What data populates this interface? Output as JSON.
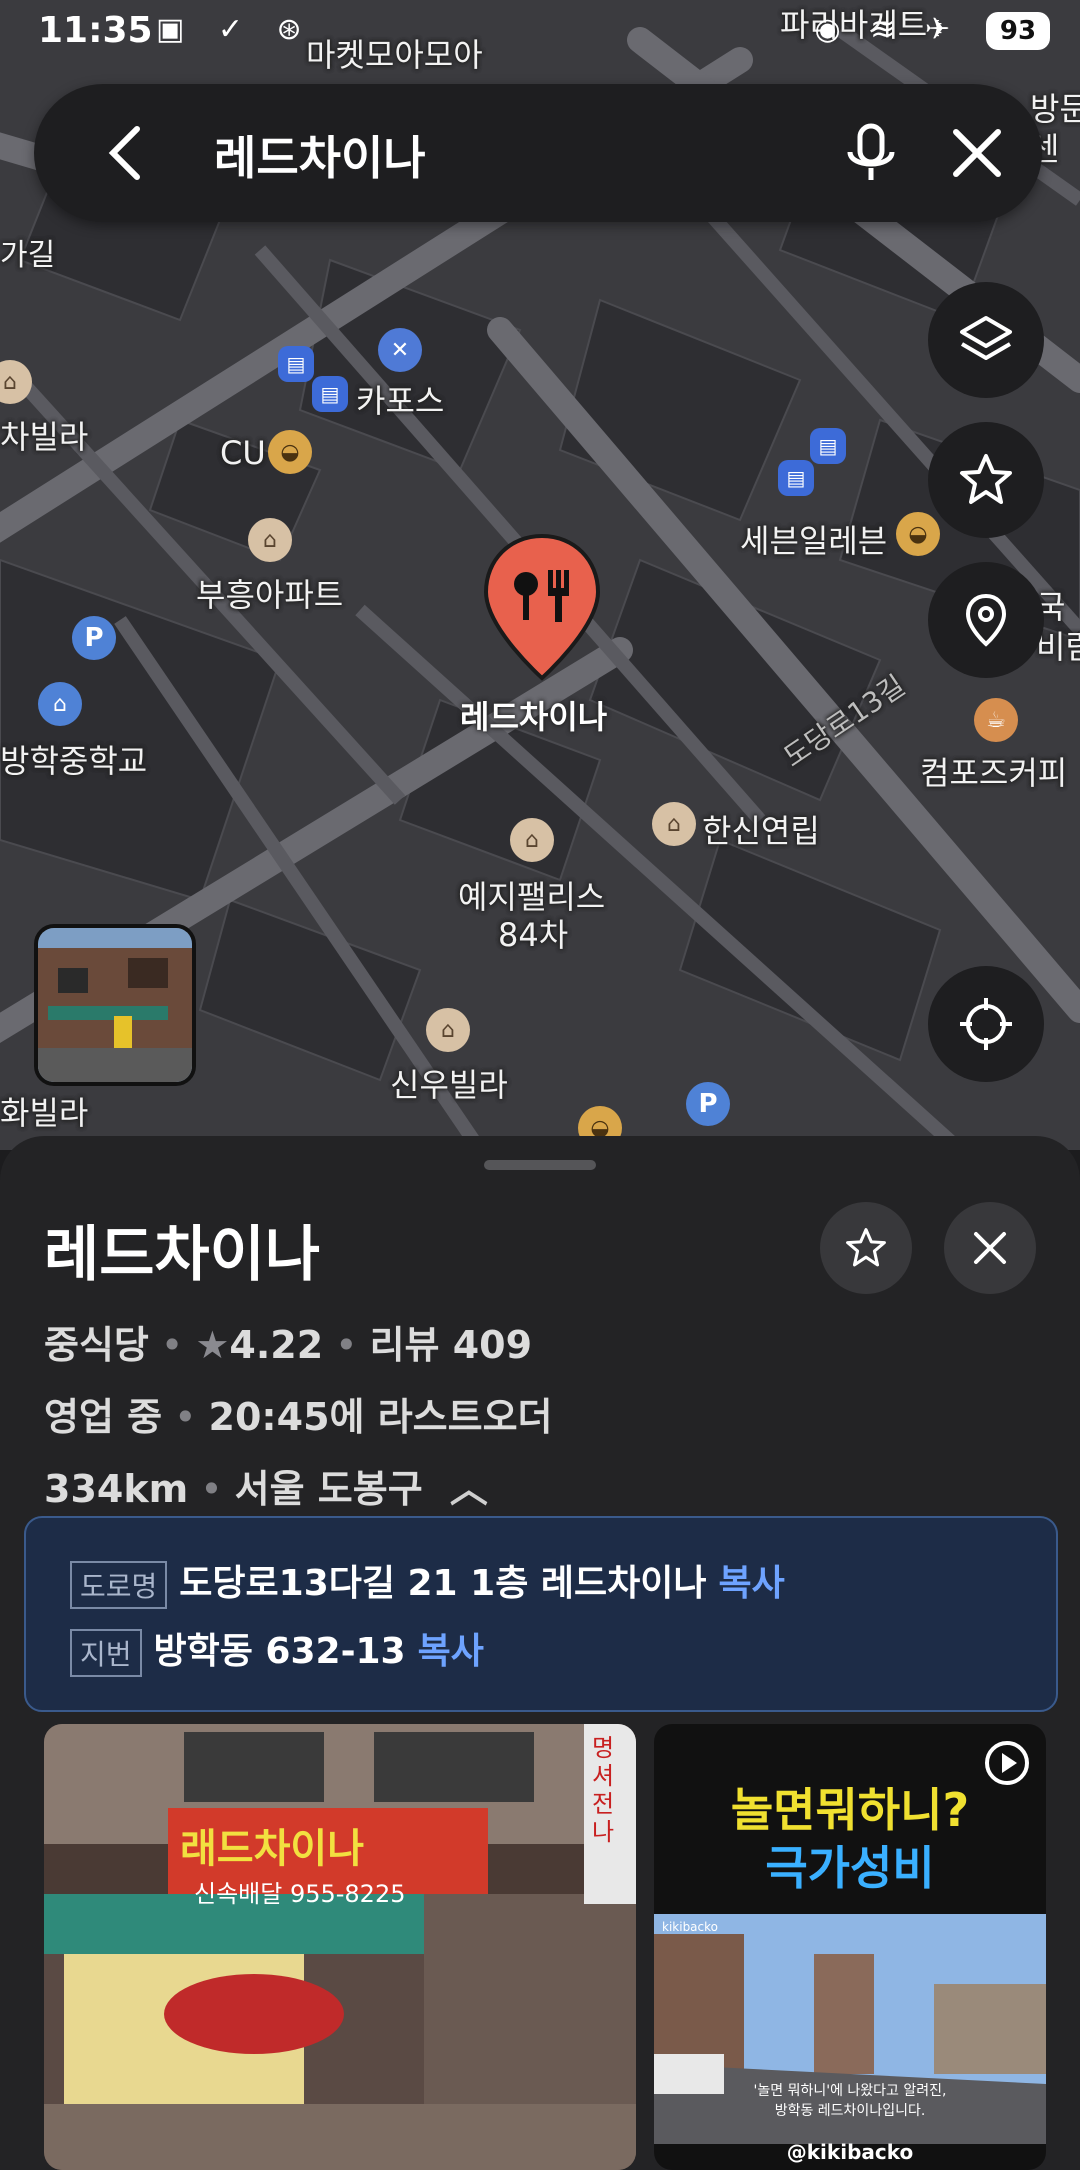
{
  "status_bar": {
    "time": "11:35",
    "left_icons": "▣ ✓ ⊛",
    "right_icons": "◉ ≋ ✈",
    "battery": "93"
  },
  "search": {
    "query": "레드차이나",
    "back_icon": "back-arrow-icon",
    "mic_icon": "mic-icon",
    "clear_icon": "close-icon"
  },
  "map": {
    "labels": {
      "market": "마켓모아모아",
      "paris": "파리바게트",
      "kapos": "카포스",
      "chavilla": "차빌라",
      "cu": "CU",
      "seven": "세븐일레븐",
      "buheung": "부흥아파트",
      "school": "방학중학교",
      "red": "레드차이나",
      "road": "도당로13길",
      "compose": "컴포즈커피",
      "hansin": "한신연립",
      "yeji1": "예지팰리스",
      "yeji2": "84차",
      "sinwoo": "신우빌라",
      "hwavilla": "화빌라",
      "gagil": "가길",
      "right1": "방문",
      "right2": "센",
      "right3": "국",
      "right4": "비람"
    },
    "fab_icons": [
      "layers-icon",
      "star-icon",
      "location-pin-icon",
      "my-location-icon"
    ]
  },
  "place": {
    "name": "레드차이나",
    "category": "중식당",
    "rating": "4.22",
    "review": "리뷰 409",
    "status": "영업 중",
    "last_order": "20:45에 라스트오더",
    "distance": "334km",
    "district": "서울 도봉구",
    "road_tag": "도로명",
    "road_address": "도당로13다길 21 1층 레드차이나",
    "lot_tag": "지번",
    "lot_address": "방학동 632-13",
    "copy_label": "복사"
  },
  "photos": {
    "sign_main": "래드차이나",
    "sign_sub": "신속배달 955-8225",
    "sign_side": "명셔전나",
    "video_title1": "놀면뭐하니?",
    "video_title2": "극가성비",
    "video_caption1": "'놀면 뭐하니'에 나왔다고 알려진,",
    "video_caption2": "방학동 레드차이나입니다.",
    "video_watermark": "kikibacko",
    "video_handle": "@kikibacko"
  },
  "colors": {
    "accent_link": "#6ea3ff",
    "marker": "#e8614d",
    "sheet_bg": "#232325",
    "address_bg": "#1d2c47"
  }
}
